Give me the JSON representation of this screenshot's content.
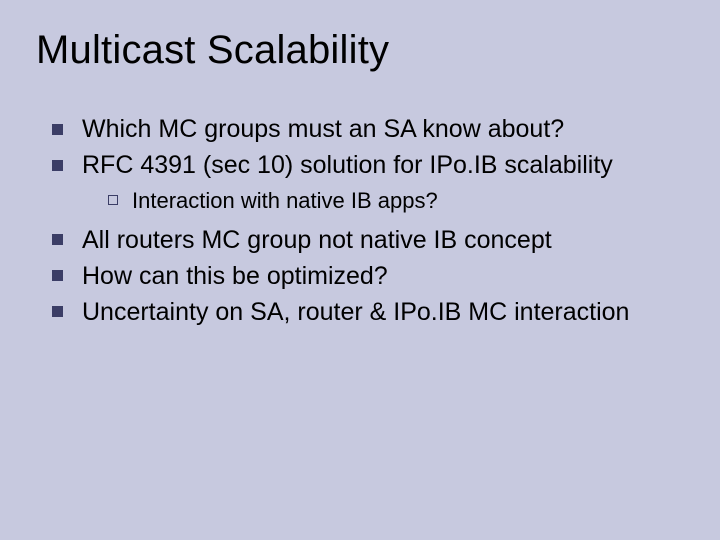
{
  "title": "Multicast Scalability",
  "bullets": {
    "b1": "Which MC groups must an SA know about?",
    "b2": "RFC 4391 (sec 10) solution for IPo.IB scalability",
    "b2_sub1": "Interaction with native IB apps?",
    "b3": "All routers MC group not native IB concept",
    "b4": "How can this be optimized?",
    "b5": "Uncertainty on SA, router & IPo.IB MC interaction"
  }
}
